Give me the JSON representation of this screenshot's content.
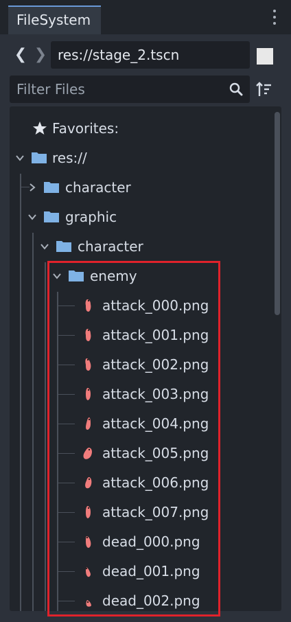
{
  "tabs": {
    "active": "FileSystem"
  },
  "navbar": {
    "path": "res://stage_2.tscn"
  },
  "filter": {
    "placeholder": "Filter Files"
  },
  "tree": {
    "favorites": "Favorites:",
    "root": "res://",
    "character": "character",
    "graphic": "graphic",
    "graphic_character": "character",
    "enemy": "enemy",
    "files": [
      "attack_000.png",
      "attack_001.png",
      "attack_002.png",
      "attack_003.png",
      "attack_004.png",
      "attack_005.png",
      "attack_006.png",
      "attack_007.png",
      "dead_000.png",
      "dead_001.png",
      "dead_002.png"
    ]
  },
  "colors": {
    "accent": "#6a9ad8",
    "folder": "#7fb2e5",
    "highlight": "#e0222b",
    "sprite": "#f07c7c"
  }
}
